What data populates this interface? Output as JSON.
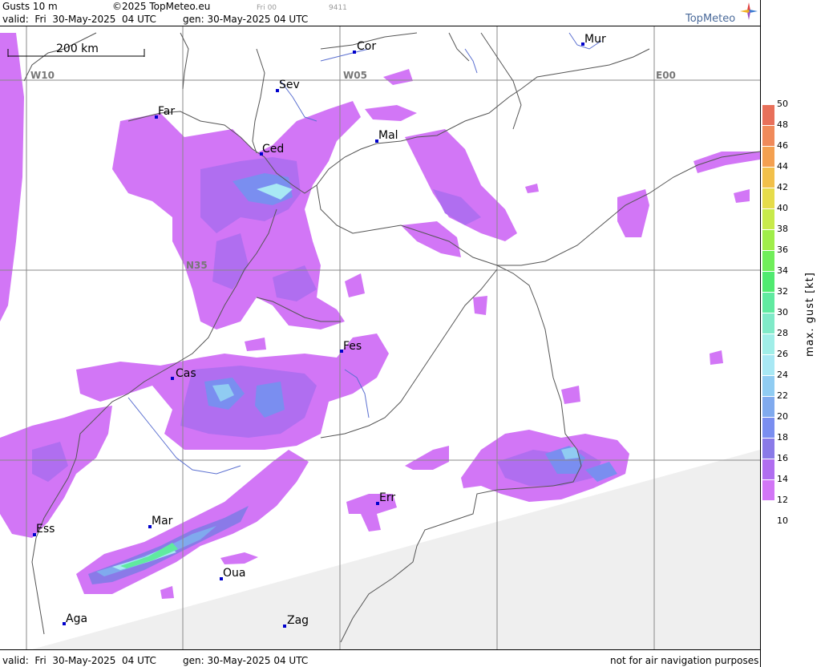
{
  "header": {
    "product": "Gusts 10 m",
    "copyright": "©2025 TopMeteo.eu",
    "run_small": "Fri 00",
    "code_small": "9411",
    "valid": "valid:  Fri  30-May-2025  04 UTC",
    "gen": "gen: 30-May-2025 04 UTC",
    "brand": "TopMeteo"
  },
  "footer": {
    "valid": "valid:  Fri  30-May-2025  04 UTC",
    "gen": "gen: 30-May-2025 04 UTC",
    "disclaimer": "not for air navigation purposes"
  },
  "scale_bar": "200 km",
  "grid_labels": [
    "W10",
    "W05",
    "E00",
    "N35"
  ],
  "cities": [
    "Cor",
    "Mur",
    "Sev",
    "Far",
    "Mal",
    "Ced",
    "Fes",
    "Cas",
    "Err",
    "Mar",
    "Ess",
    "Oua",
    "Aga",
    "Zag"
  ],
  "legend": {
    "title": "max. gust [kt]",
    "ticks": [
      "50",
      "48",
      "46",
      "44",
      "42",
      "40",
      "38",
      "36",
      "34",
      "32",
      "30",
      "28",
      "26",
      "24",
      "22",
      "20",
      "18",
      "16",
      "14",
      "12",
      "10"
    ],
    "colors": [
      "#e8705a",
      "#f08a5a",
      "#f4a050",
      "#f2c04a",
      "#e6dc4a",
      "#c8ea4a",
      "#a0ee4a",
      "#70ee5a",
      "#50ea70",
      "#60eaa0",
      "#80eac8",
      "#a0eee8",
      "#a8e8f4",
      "#90ccf2",
      "#80aaee",
      "#7a8ef0",
      "#8a7ae8",
      "#b06ef0",
      "#d276f6"
    ]
  }
}
